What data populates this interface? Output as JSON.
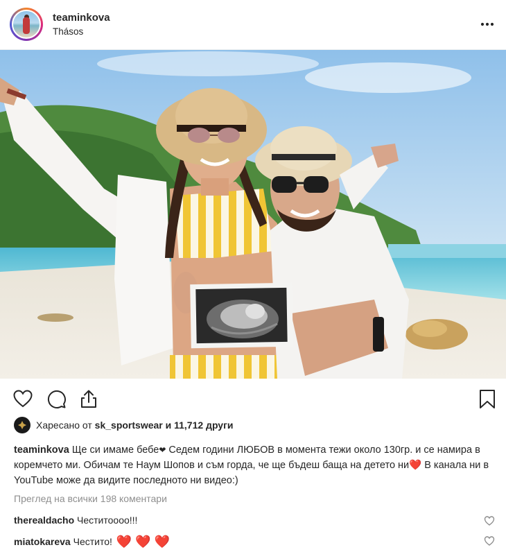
{
  "post": {
    "username": "teaminkova",
    "location": "Thásos",
    "more_label": "•••"
  },
  "likes": {
    "prefix": "Харесано от ",
    "liker": "sk_sportswear",
    "suffix": " и 11,712 други"
  },
  "caption": {
    "author": "teaminkova",
    "part1": " Ще си имаме бебе",
    "part2": " Седем години ЛЮБОВ в момента тежи около 130гр. и се намира в коремчето ми. Обичам те Наум Шопов и съм горда, че ще бъдеш баща на детето ни",
    "part3": " В канала ни в YouTube може да видите последното ни видео:)"
  },
  "view_all_comments": "Преглед на всички 198 коментари",
  "comments": [
    {
      "author": "therealdacho",
      "text": " Честитоооо!!!",
      "hearts": ""
    },
    {
      "author": "miatokareva",
      "text": " Честито! ",
      "hearts": "❤️ ❤️ ❤️"
    }
  ],
  "icons": {
    "like": "heart-outline-icon",
    "comment": "speech-bubble-icon",
    "share": "share-icon",
    "save": "bookmark-icon"
  },
  "colors": {
    "text": "#262626",
    "muted": "#8e8e8e",
    "heart_red": "#ed2b3a",
    "border": "#efefef"
  }
}
